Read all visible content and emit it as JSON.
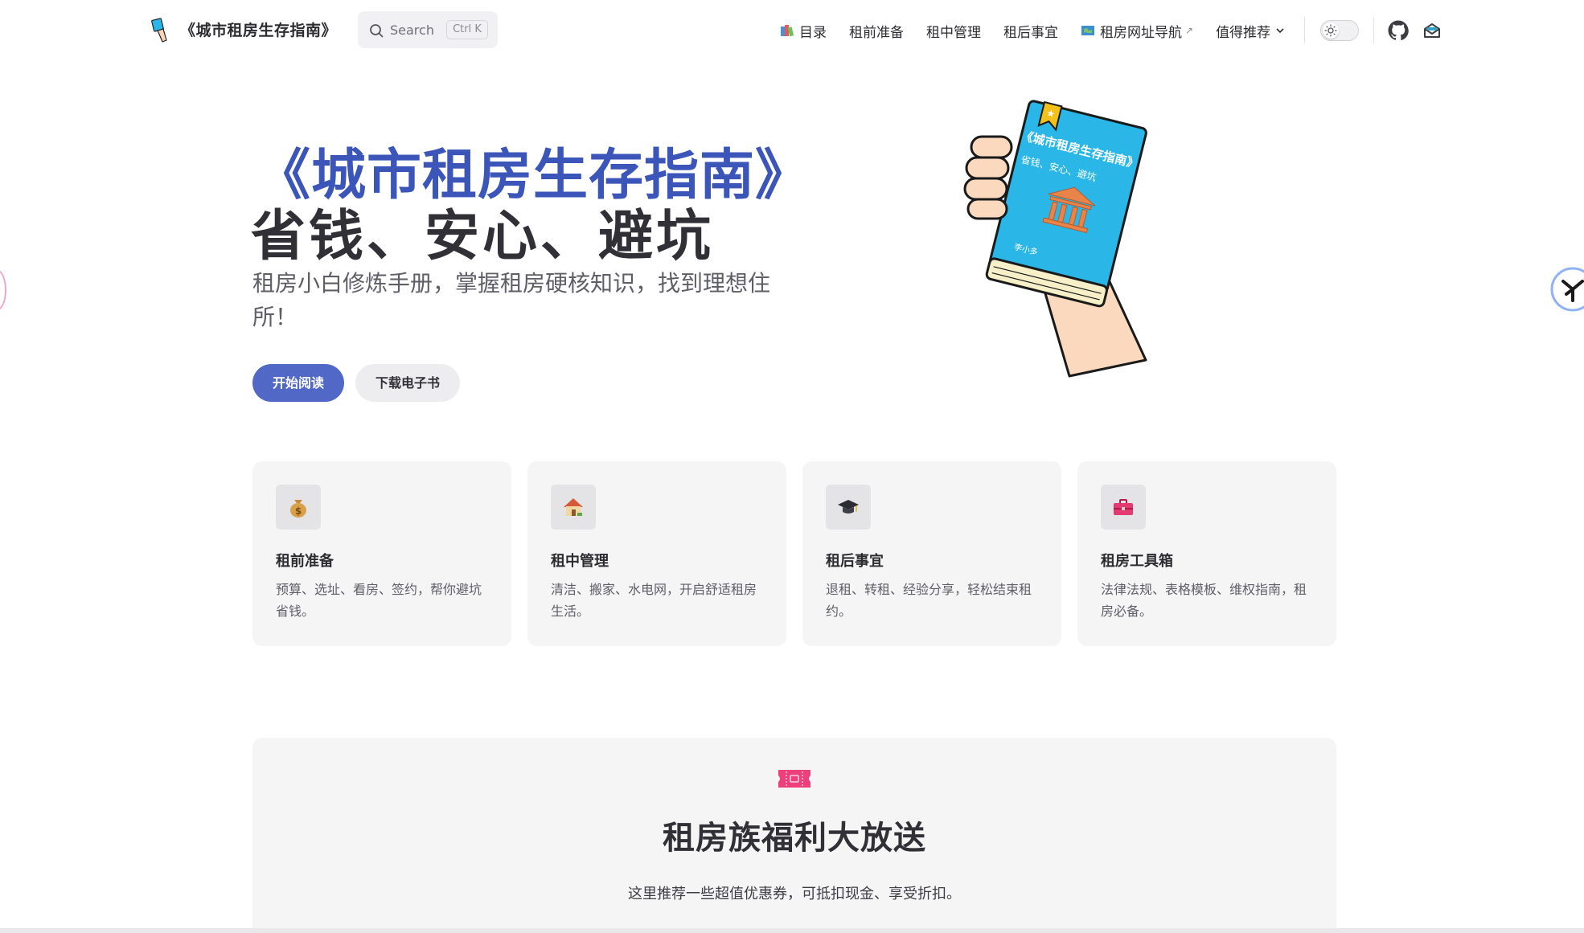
{
  "nav": {
    "brand": "《城市租房生存指南》",
    "search": {
      "label": "Search",
      "shortcut": "Ctrl K"
    },
    "links": [
      {
        "label": "目录",
        "icon": "books-icon"
      },
      {
        "label": "租前准备"
      },
      {
        "label": "租中管理"
      },
      {
        "label": "租后事宜"
      },
      {
        "label": "租房网址导航",
        "icon": "map-icon",
        "external": "↗"
      },
      {
        "label": "值得推荐",
        "icon": "chevron-down-icon"
      }
    ]
  },
  "hero": {
    "title_line1": "《城市租房生存指南》",
    "title_line2": "省钱、安心、避坑",
    "tagline": "租房小白修炼手册，掌握租房硬核知识，找到理想住所！",
    "primary_button": "开始阅读",
    "secondary_button": "下载电子书",
    "book_cover": {
      "title": "《城市租房生存指南》",
      "subtitle": "省钱、安心、避坑",
      "author": "李小多"
    }
  },
  "features": [
    {
      "icon": "money-bag-icon",
      "title": "租前准备",
      "desc": "预算、选址、看房、签约，帮你避坑省钱。"
    },
    {
      "icon": "house-icon",
      "title": "租中管理",
      "desc": "清洁、搬家、水电网，开启舒适租房生活。"
    },
    {
      "icon": "graduation-cap-icon",
      "title": "租后事宜",
      "desc": "退租、转租、经验分享，轻松结束租约。"
    },
    {
      "icon": "toolbox-icon",
      "title": "租房工具箱",
      "desc": "法律法规、表格模板、维权指南，租房必备。"
    }
  ],
  "promo": {
    "icon": "ticket-icon",
    "title": "租房族福利大放送",
    "subtitle": "这里推荐一些超值优惠券，可抵扣现金、享受折扣。"
  },
  "colors": {
    "accent": "#3b55b8",
    "primary_button": "#5168c7",
    "card_bg": "#f5f5f6",
    "book_blue": "#2bb6e8"
  }
}
